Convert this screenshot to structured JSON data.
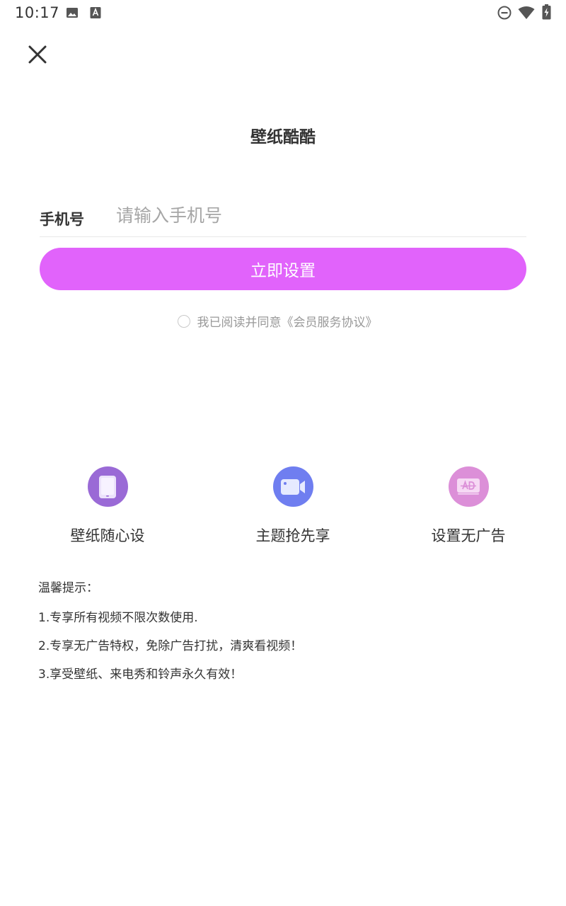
{
  "status_bar": {
    "time": "10:17",
    "icons": [
      "image-icon",
      "font-icon",
      "do-not-disturb-icon",
      "wifi-icon",
      "battery-charging-icon"
    ]
  },
  "header": {
    "close_icon": "close-icon"
  },
  "app_title": "壁纸酷酷",
  "form": {
    "phone_label": "手机号",
    "phone_value": "",
    "phone_placeholder": "请输入手机号",
    "submit_label": "立即设置",
    "agreement_text": "我已阅读并同意《会员服务协议》",
    "agreement_checked": false
  },
  "features": [
    {
      "label": "壁纸随心设",
      "icon": "phone-icon",
      "color": "#9a6ad6"
    },
    {
      "label": "主题抢先享",
      "icon": "video-camera-icon",
      "color": "#6f7ef0"
    },
    {
      "label": "设置无广告",
      "icon": "no-ad-icon",
      "color": "#dc8fd8"
    }
  ],
  "tips": {
    "title": "温馨提示：",
    "items": [
      "1.专享所有视频不限次数使用.",
      "2.专享无广告特权，免除广告打扰，清爽看视频！",
      "3.享受壁纸、来电秀和铃声永久有效！"
    ]
  },
  "colors": {
    "accent": "#e163fb",
    "text": "#333333",
    "placeholder": "#a6a6a6",
    "muted": "#999999"
  }
}
